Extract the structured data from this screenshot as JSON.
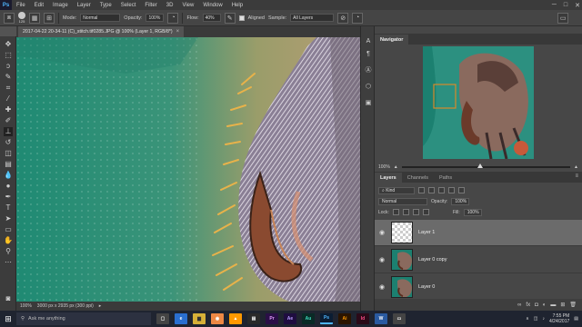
{
  "menubar": {
    "logo": "Ps",
    "items": [
      "File",
      "Edit",
      "Image",
      "Layer",
      "Type",
      "Select",
      "Filter",
      "3D",
      "View",
      "Window",
      "Help"
    ]
  },
  "options": {
    "brush_size": "125",
    "mode_label": "Mode:",
    "mode_value": "Normal",
    "opacity_label": "Opacity:",
    "opacity_value": "100%",
    "flow_label": "Flow:",
    "flow_value": "40%",
    "aligned_label": "Aligned",
    "sample_label": "Sample:",
    "sample_value": "All Layers"
  },
  "document": {
    "tab_title": "2017-04-22 20-34-11 (C)_stitch.tif0285.JPG @ 100% (Layer 1, RGB/8*)",
    "zoom": "100%",
    "dimensions": "3000 px x 2935 px (300 ppi)"
  },
  "navigator": {
    "title": "Navigator",
    "zoom": "100%"
  },
  "layers_panel": {
    "tabs": [
      "Layers",
      "Channels",
      "Paths"
    ],
    "kind_label": "Kind",
    "blend_mode": "Normal",
    "opacity_label": "Opacity:",
    "opacity_value": "100%",
    "lock_label": "Lock:",
    "fill_label": "Fill:",
    "fill_value": "100%",
    "layers": [
      {
        "name": "Layer 1",
        "selected": true
      },
      {
        "name": "Layer 0 copy",
        "selected": false
      },
      {
        "name": "Layer 0",
        "selected": false
      }
    ]
  },
  "taskbar": {
    "search_placeholder": "Ask me anything",
    "apps": [
      "Pr",
      "Ae",
      "Au",
      "Ps",
      "Ai",
      "Id"
    ],
    "time": "7:55 PM",
    "date": "4/24/2017"
  },
  "colors": {
    "foreground": "#c6a46a",
    "background": "#f0f0f0",
    "accent": "#4fb6ff"
  }
}
